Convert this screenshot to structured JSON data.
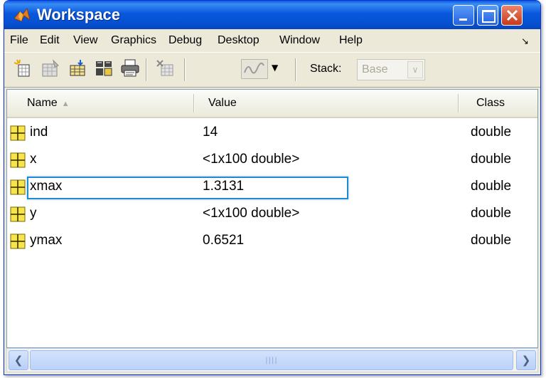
{
  "window": {
    "title": "Workspace"
  },
  "menu": [
    "File",
    "Edit",
    "View",
    "Graphics",
    "Debug",
    "Desktop",
    "Window",
    "Help"
  ],
  "toolbar": {
    "icons": [
      "new-variable-icon",
      "open-variable-icon",
      "import-data-icon",
      "save-icon",
      "print-icon",
      "delete-icon",
      "plot-icon"
    ],
    "stack_label": "Stack:",
    "stack_value": "Base"
  },
  "columns": {
    "name": "Name",
    "value": "Value",
    "class": "Class"
  },
  "rows": [
    {
      "name": "ind",
      "value": "14",
      "class": "double"
    },
    {
      "name": "x",
      "value": "<1x100 double>",
      "class": "double"
    },
    {
      "name": "xmax",
      "value": "1.3131",
      "class": "double"
    },
    {
      "name": "y",
      "value": "<1x100 double>",
      "class": "double"
    },
    {
      "name": "ymax",
      "value": "0.6521",
      "class": "double"
    }
  ],
  "selected_row": "xmax"
}
